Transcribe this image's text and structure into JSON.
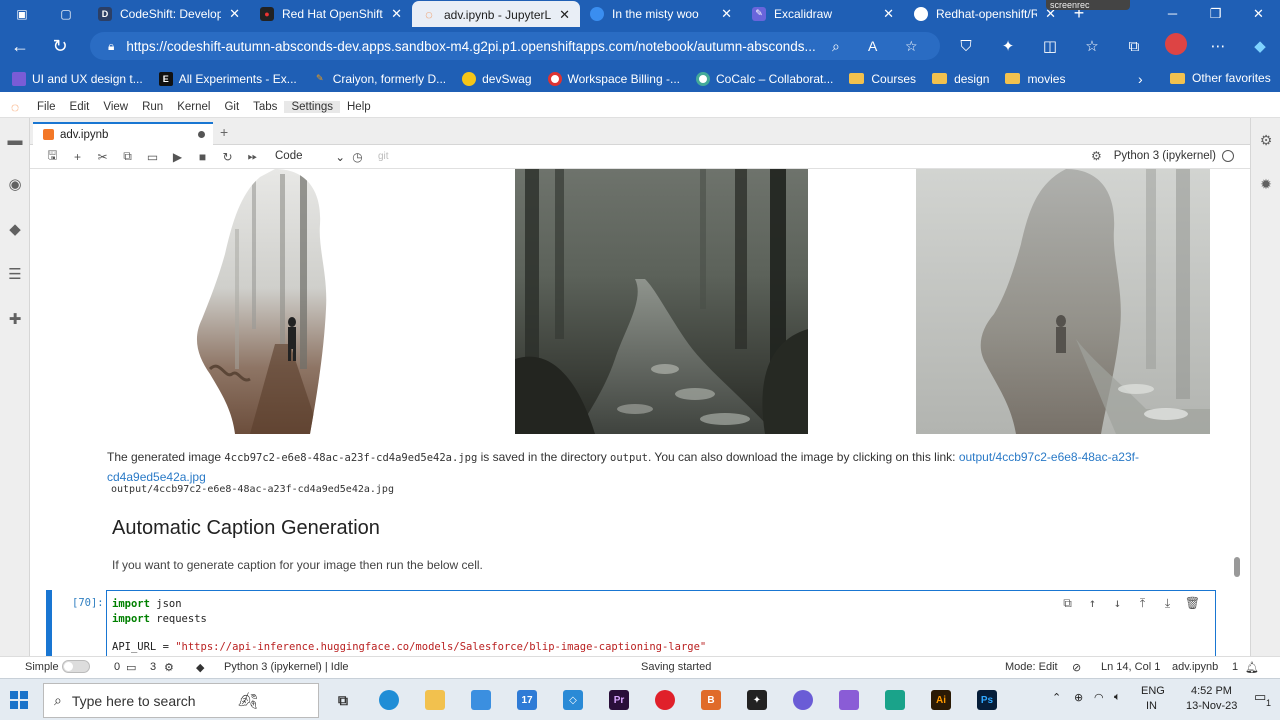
{
  "browser": {
    "tabs": [
      {
        "title": "CodeShift: Developin",
        "icon": "codeshift-icon",
        "active": false
      },
      {
        "title": "Red Hat OpenShift D",
        "icon": "redhat-icon",
        "active": false
      },
      {
        "title": "adv.ipynb - JupyterLa",
        "icon": "jupyter-icon",
        "active": true
      },
      {
        "title": "In the misty woo",
        "icon": "chat-icon",
        "active": false
      },
      {
        "title": "Excalidraw",
        "icon": "excalidraw-icon",
        "active": false
      },
      {
        "title": "Redhat-openshift/RE",
        "icon": "github-icon",
        "active": false
      }
    ],
    "screenrec_label": "screenrec",
    "url": "https://codeshift-autumn-absconds-dev.apps.sandbox-m4.g2pi.p1.openshiftapps.com/notebook/autumn-absconds...",
    "favorites": [
      {
        "label": "UI and UX design t...",
        "icon": "puzzle-icon"
      },
      {
        "label": "All Experiments - Ex...",
        "icon": "e-icon"
      },
      {
        "label": "Craiyon, formerly D...",
        "icon": "crayon-icon"
      },
      {
        "label": "devSwag",
        "icon": "sunglasses-icon"
      },
      {
        "label": "Workspace Billing -...",
        "icon": "circle-icon"
      },
      {
        "label": "CoCalc – Collaborat...",
        "icon": "cocalc-icon"
      },
      {
        "label": "Courses",
        "icon": "folder-icon"
      },
      {
        "label": "design",
        "icon": "folder-icon"
      },
      {
        "label": "movies",
        "icon": "folder-icon"
      }
    ],
    "other_favorites": "Other favorites"
  },
  "jupyter": {
    "menu": [
      "File",
      "Edit",
      "View",
      "Run",
      "Kernel",
      "Git",
      "Tabs",
      "Settings",
      "Help"
    ],
    "doc_tab": "adv.ipynb",
    "cell_type": "Code",
    "git_label": "git",
    "kernel_name": "Python 3 (ipykernel)"
  },
  "notebook": {
    "output_prefix": "The generated image ",
    "output_filename": "4ccb97c2-e6e8-48ac-a23f-cd4a9ed5e42a.jpg",
    "output_middle": " is saved in the directory ",
    "output_dir": "output",
    "output_suffix": ". You can also download the image by clicking on this link: ",
    "output_link": "output/4ccb97c2-e6e8-48ac-a23f-cd4a9ed5e42a.jpg",
    "output_path": "output/4ccb97c2-e6e8-48ac-a23f-cd4a9ed5e42a.jpg",
    "heading": "Automatic Caption Generation",
    "paragraph": "If you want to generate caption for your image then run the below cell.",
    "cell_prompt": "[70]:",
    "code_line1_kw": "import",
    "code_line1_mod": " json",
    "code_line2_kw": "import",
    "code_line2_mod": " requests",
    "code_line3_var": "API_URL = ",
    "code_line3_str": "\"https://api-inference.huggingface.co/models/Salesforce/blip-image-captioning-large\""
  },
  "statusbar": {
    "mode_toggle": "Simple",
    "count_a": "0",
    "count_b": "3",
    "kernel_status": "Python 3 (ipykernel) | Idle",
    "saving": "Saving started",
    "mode": "Mode: Edit",
    "cursor": "Ln 14, Col 1",
    "filename": "adv.ipynb",
    "notif_count": "1"
  },
  "taskbar": {
    "search_placeholder": "Type here to search",
    "lang": "ENG",
    "region": "IN",
    "time": "4:52 PM",
    "date": "13-Nov-23",
    "mail_badge": "17",
    "notif_count": "1"
  }
}
